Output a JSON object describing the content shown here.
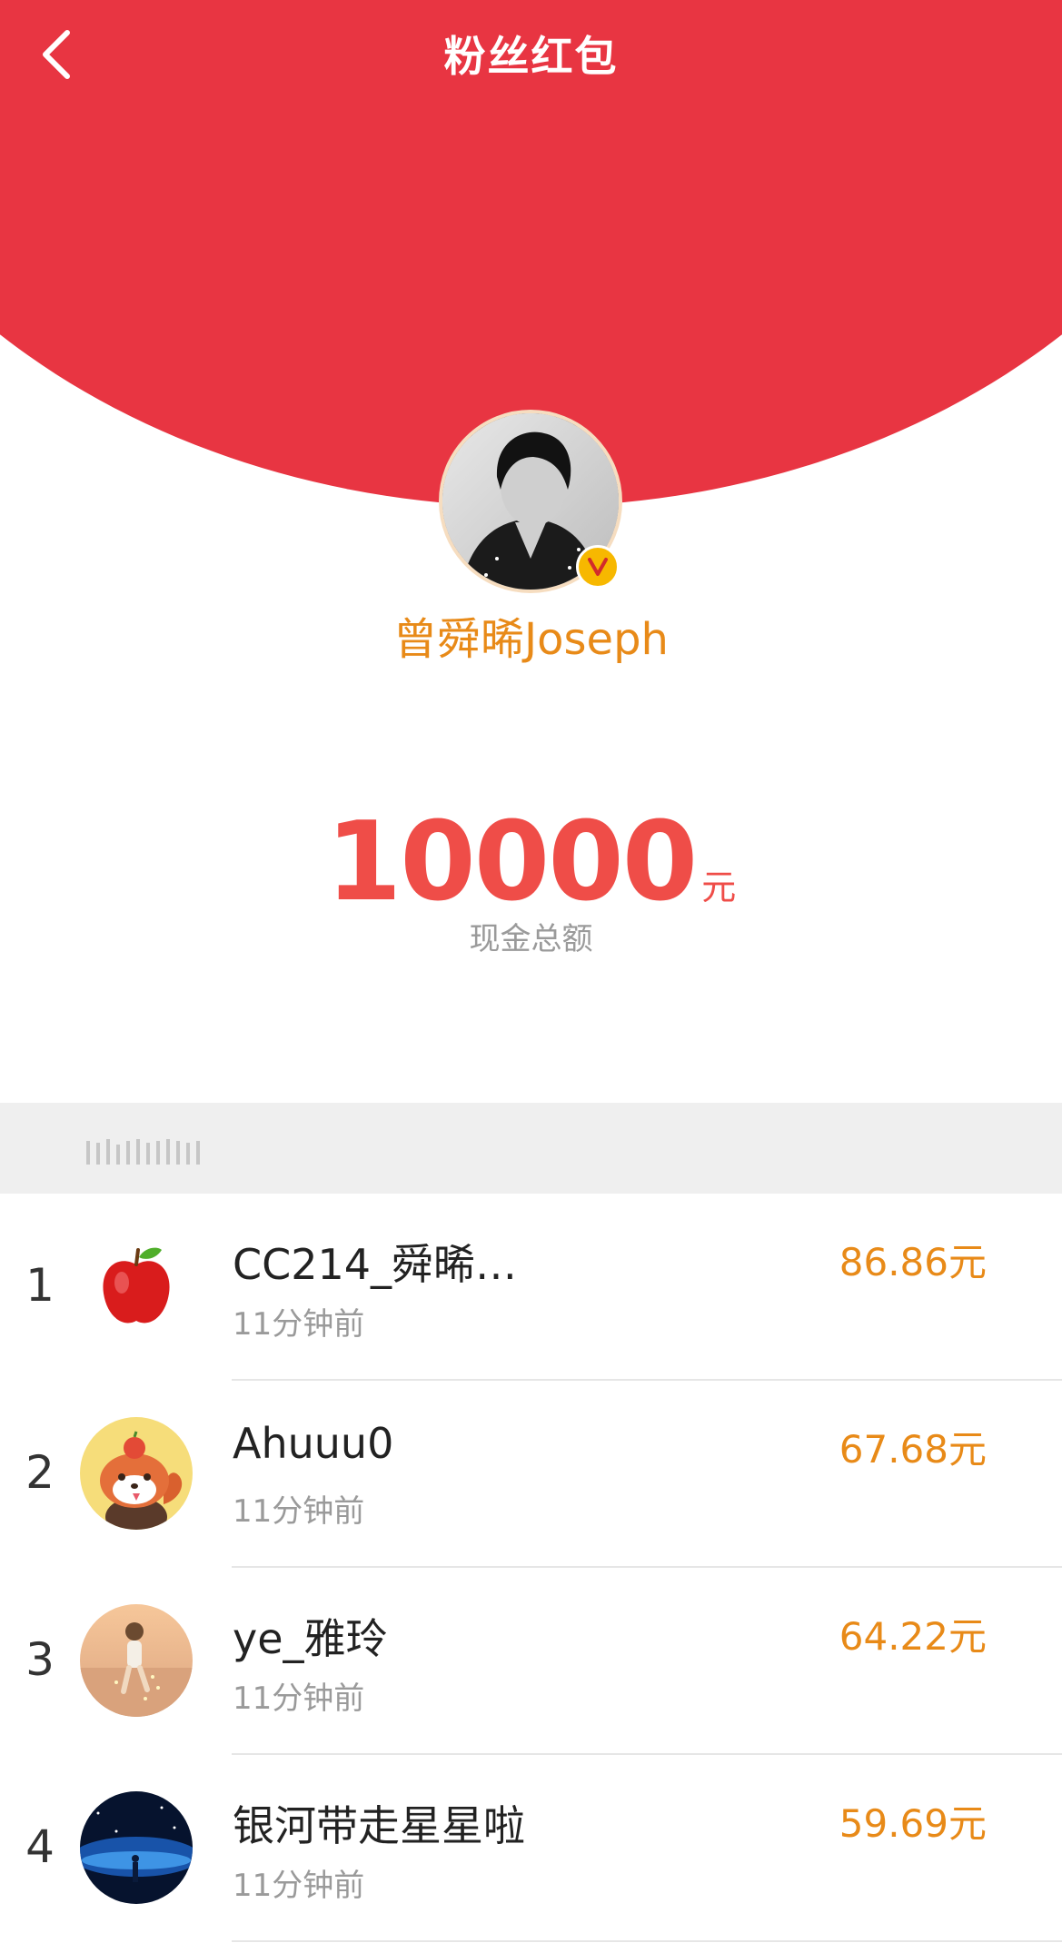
{
  "header": {
    "title": "粉丝红包",
    "back_icon": "chevron-left-icon",
    "background_color": "#e83542"
  },
  "owner": {
    "name": "曾舜晞Joseph",
    "verified_icon": "verified-v-icon",
    "name_color": "#e88a18"
  },
  "total": {
    "amount": "10000",
    "unit": "元",
    "label": "现金总额",
    "color": "#ef4d48"
  },
  "recipients": [
    {
      "rank": "1",
      "name": "CC214_舜晞…",
      "time": "11分钟前",
      "amount": "86.86元",
      "avatar_icon": "apple-icon"
    },
    {
      "rank": "2",
      "name": "Ahuuu0",
      "time": "11分钟前",
      "amount": "67.68元",
      "avatar_icon": "red-panda-avatar"
    },
    {
      "rank": "3",
      "name": "ye_雅玲",
      "time": "11分钟前",
      "amount": "64.22元",
      "avatar_icon": "beach-child-avatar"
    },
    {
      "rank": "4",
      "name": "银河带走星星啦",
      "time": "11分钟前",
      "amount": "59.69元",
      "avatar_icon": "galaxy-avatar"
    }
  ]
}
